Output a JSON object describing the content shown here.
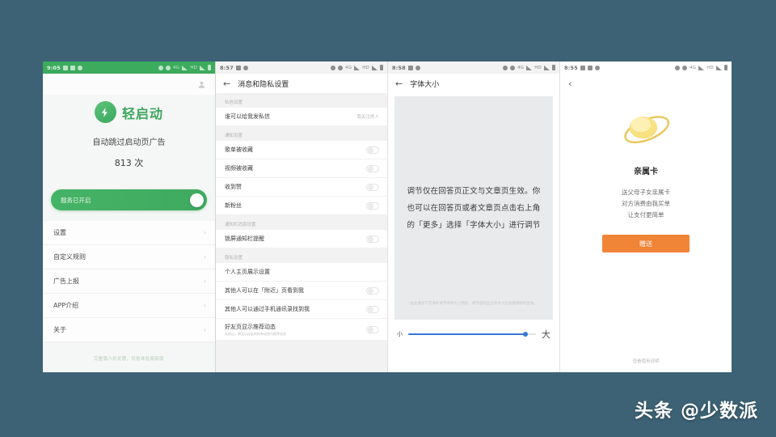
{
  "background_color": "#3d6275",
  "watermark": "头条 @少数派",
  "phones": [
    {
      "id": "phone-quick-start",
      "status_bar": {
        "time": "9:05",
        "theme": "green",
        "carrier": "",
        "signal_label": "HD"
      },
      "app": {
        "name": "轻启动",
        "icon": "bolt-icon",
        "profile_icon": "person-icon",
        "subtitle": "自动跳过启动页广告",
        "count": "813 次",
        "service_toggle": {
          "label": "服务已开启",
          "enabled": true
        },
        "menu": [
          {
            "label": "设置",
            "chevron": "›"
          },
          {
            "label": "自定义规则",
            "chevron": "›"
          },
          {
            "label": "广告上报",
            "chevron": "›"
          },
          {
            "label": "APP介绍",
            "chevron": "›"
          },
          {
            "label": "关于",
            "chevron": "›"
          }
        ],
        "footnote": "完整版八折优惠，仅售体验版新版"
      }
    },
    {
      "id": "phone-privacy-settings",
      "status_bar": {
        "time": "8:57",
        "theme": "light",
        "signal_label": "HD"
      },
      "nav": {
        "back_icon": "back-arrow-icon",
        "title": "消息和隐私设置"
      },
      "sections": [
        {
          "header": "私信设置",
          "rows": [
            {
              "label": "谁可以给我发私信",
              "value": "我关注的人",
              "type": "value"
            }
          ]
        },
        {
          "header": "通知设置",
          "rows": [
            {
              "label": "歌单被收藏",
              "type": "switch",
              "on": false
            },
            {
              "label": "视频被收藏",
              "type": "switch",
              "on": false
            },
            {
              "label": "收到赞",
              "type": "switch",
              "on": false
            },
            {
              "label": "新粉丝",
              "type": "switch",
              "on": false
            }
          ]
        },
        {
          "header": "通知栏消息设置",
          "rows": [
            {
              "label": "锁屏通知栏提醒",
              "type": "switch",
              "on": false
            }
          ]
        },
        {
          "header": "隐私设置",
          "rows": [
            {
              "label": "个人主页展示设置",
              "type": "plain"
            },
            {
              "label": "其他人可以在「附近」页看到我",
              "type": "switch",
              "on": false
            },
            {
              "label": "其他人可以通过手机通讯录找到我",
              "type": "switch",
              "on": false
            },
            {
              "label": "好友页显示推荐动态",
              "sublabel": "关闭后，将显示好友的所有动态与推荐动态",
              "type": "switch",
              "on": false
            }
          ]
        }
      ]
    },
    {
      "id": "phone-font-size",
      "status_bar": {
        "time": "8:58",
        "theme": "light",
        "signal_label": "HD"
      },
      "nav": {
        "back_icon": "back-arrow-icon",
        "title": "字体大小"
      },
      "preview": {
        "text": "调节仅在回答页正文与文章页生效。你也可以在回答页或者文章页点击右上角的「更多」选择「字体大小」进行调节",
        "note": "左右滑动下方滑杆调节字体大小预览，调节后的正文字大小生效都将即时生效。"
      },
      "slider": {
        "min_label": "小",
        "max_label": "大",
        "value_percent": 92,
        "accent_color": "#3778d6"
      }
    },
    {
      "id": "phone-family-card",
      "status_bar": {
        "time": "8:55",
        "theme": "white",
        "signal_label": "HD"
      },
      "nav": {
        "back_icon": "chevron-left-icon",
        "title": ""
      },
      "card": {
        "art": "family-card-illustration",
        "title": "亲属卡",
        "lines": [
          "送父母子女亲属卡",
          "对方消费由我买单",
          "让支付更简单"
        ],
        "primary_button": "赠送",
        "primary_button_color": "#f08437",
        "footer_link": "查看使用说明"
      }
    }
  ]
}
